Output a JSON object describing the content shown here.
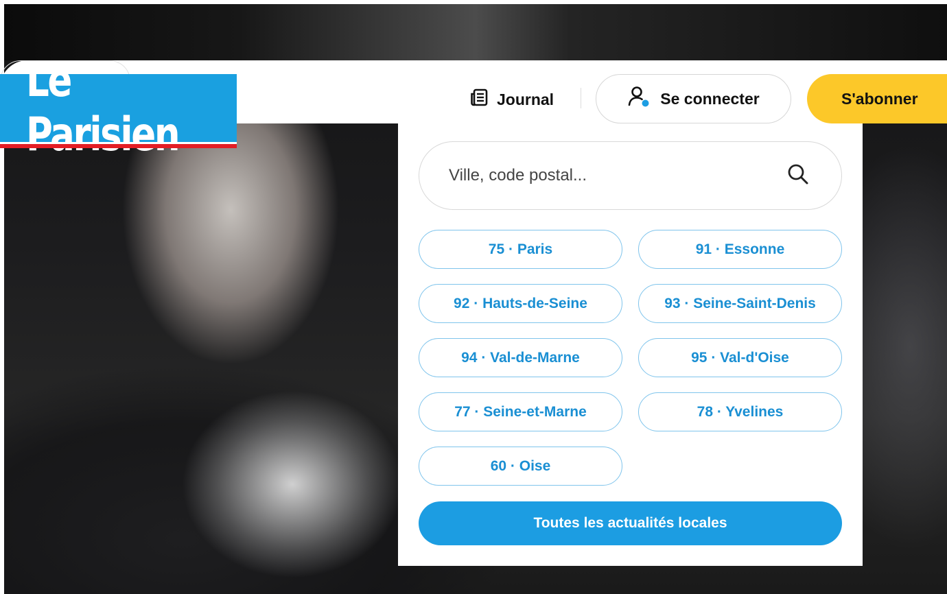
{
  "brand": {
    "logo_text": "Le Parisien",
    "logo_color": "#1aa0e0",
    "underline_color": "#e31e25"
  },
  "header": {
    "journal_label": "Journal",
    "journal_icon": "newspaper-icon",
    "connect_label": "Se connecter",
    "connect_icon": "user-icon",
    "subscribe_label": "S'abonner",
    "subscribe_color": "#fcc829"
  },
  "local_panel": {
    "search": {
      "placeholder": "Ville, code postal...",
      "icon": "search-icon"
    },
    "departments": [
      {
        "label": "75 · Paris"
      },
      {
        "label": "91 · Essonne"
      },
      {
        "label": "92 · Hauts-de-Seine"
      },
      {
        "label": "93 · Seine-Saint-Denis"
      },
      {
        "label": "94 · Val-de-Marne"
      },
      {
        "label": "95 · Val-d'Oise"
      },
      {
        "label": "77 · Seine-et-Marne"
      },
      {
        "label": "78 · Yvelines"
      },
      {
        "label": "60 · Oise"
      }
    ],
    "all_news_label": "Toutes les actualités locales",
    "accent_color": "#1c9de2"
  }
}
